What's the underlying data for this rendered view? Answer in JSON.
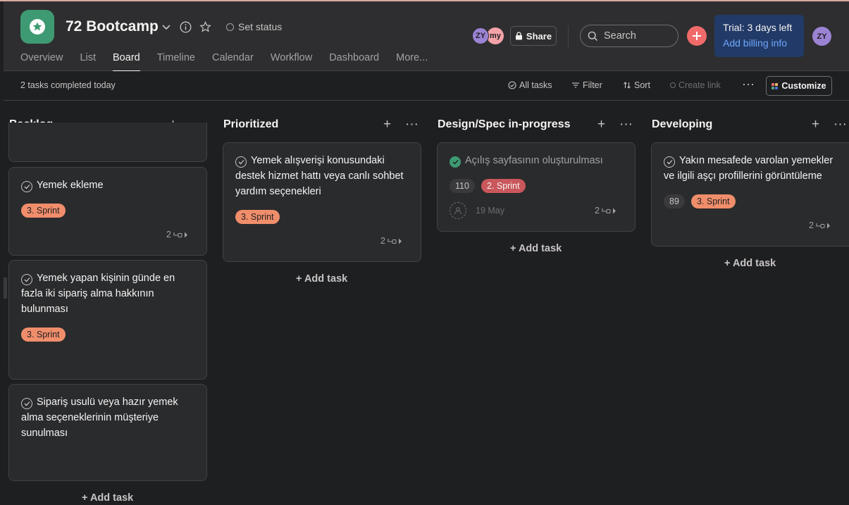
{
  "project": {
    "title": "72 Bootcamp",
    "status_label": "Set status",
    "icon": "star-icon",
    "color": "#3e9a72"
  },
  "nav": {
    "tabs": [
      "Overview",
      "List",
      "Board",
      "Timeline",
      "Calendar",
      "Workflow",
      "Dashboard",
      "More..."
    ],
    "active": "Board"
  },
  "header_right": {
    "members": [
      "ZY",
      "my"
    ],
    "share_label": "Share",
    "search_placeholder": "Search",
    "trial_text": "Trial: 3 days left",
    "billing_link": "Add billing info",
    "user_initials": "ZY"
  },
  "toolbar": {
    "completed_text": "2 tasks completed today",
    "all_tasks": "All tasks",
    "filter": "Filter",
    "sort": "Sort",
    "create_link": "Create link",
    "customize": "Customize"
  },
  "columns": [
    {
      "title": "Backlog",
      "cards": [
        {
          "title": "Yemek ekleme",
          "tag": "3. Sprint",
          "subtasks": "2"
        },
        {
          "title": "Yemek yapan kişinin günde en fazla iki sipariş alma hakkının bulunması",
          "tag": "3. Sprint",
          "subtasks": ""
        },
        {
          "title": "Sipariş usulü veya hazır yemek alma seçeneklerinin müşteriye sunulması",
          "tag": "",
          "subtasks": ""
        }
      ],
      "add_task": "+ Add task"
    },
    {
      "title": "Prioritized",
      "cards": [
        {
          "title": "Yemek alışverişi konusundaki destek hizmet hattı veya canlı sohbet yardım seçenekleri",
          "tag": "3. Sprint",
          "subtasks": "2"
        }
      ],
      "add_task": "+ Add task"
    },
    {
      "title": "Design/Spec in-progress",
      "cards": [
        {
          "title": "Açılış sayfasının oluşturulması",
          "number": "110",
          "tag": "2. Sprint",
          "date": "19 May",
          "subtasks": "2",
          "completed": true
        }
      ],
      "add_task": "+ Add task"
    },
    {
      "title": "Developing",
      "cards": [
        {
          "title": "Yakın mesafede varolan yemekler ve ilgili aşçı profillerini görüntüleme",
          "number": "89",
          "tag": "3. Sprint",
          "subtasks": "2"
        }
      ],
      "add_task": "+ Add task"
    }
  ],
  "colors": {
    "sprint3": "#f08e6b",
    "sprint2": "#c9575b",
    "accent_red": "#f06a6a",
    "trial_bg": "#223a67"
  }
}
